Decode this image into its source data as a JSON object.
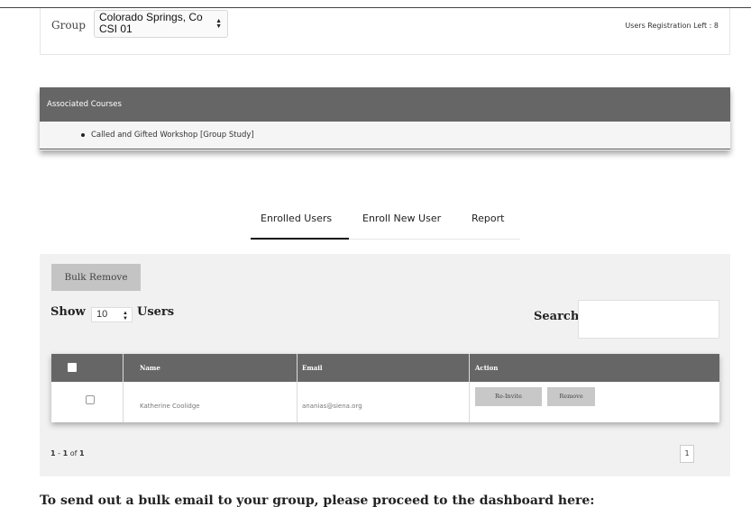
{
  "group": {
    "label": "Group",
    "selected_value": "Colorado Springs, Co CSI 01",
    "registrations_left": "Users Registration Left : 8"
  },
  "courses": {
    "header": "Associated Courses",
    "items": [
      "Called and Gifted Workshop [Group Study]"
    ]
  },
  "tabs": [
    {
      "label": "Enrolled Users",
      "active": true
    },
    {
      "label": "Enroll New User",
      "active": false
    },
    {
      "label": "Report",
      "active": false
    }
  ],
  "toolbar": {
    "bulk_remove_label": "Bulk Remove",
    "show_label": "Show",
    "page_size": "10",
    "users_label": "Users",
    "search_label": "Search",
    "search_value": ""
  },
  "table": {
    "columns": [
      "Name",
      "Email",
      "Action"
    ],
    "rows": [
      {
        "name": "Katherine Coolidge",
        "email": "ananias@siena.org",
        "checked": false,
        "actions": [
          "Re-Invite",
          "Remove"
        ]
      }
    ]
  },
  "pagination": {
    "range_start": "1",
    "range_end": "1",
    "of_label": "of",
    "total": "1",
    "current_page": "1"
  },
  "footer": {
    "bulk_email_text": "To send out a bulk email to your group, please proceed to the dashboard here:"
  },
  "colors": {
    "header_gray": "#666666",
    "panel_bg": "#f1f1f1",
    "button_gray": "#c4c4c4"
  }
}
